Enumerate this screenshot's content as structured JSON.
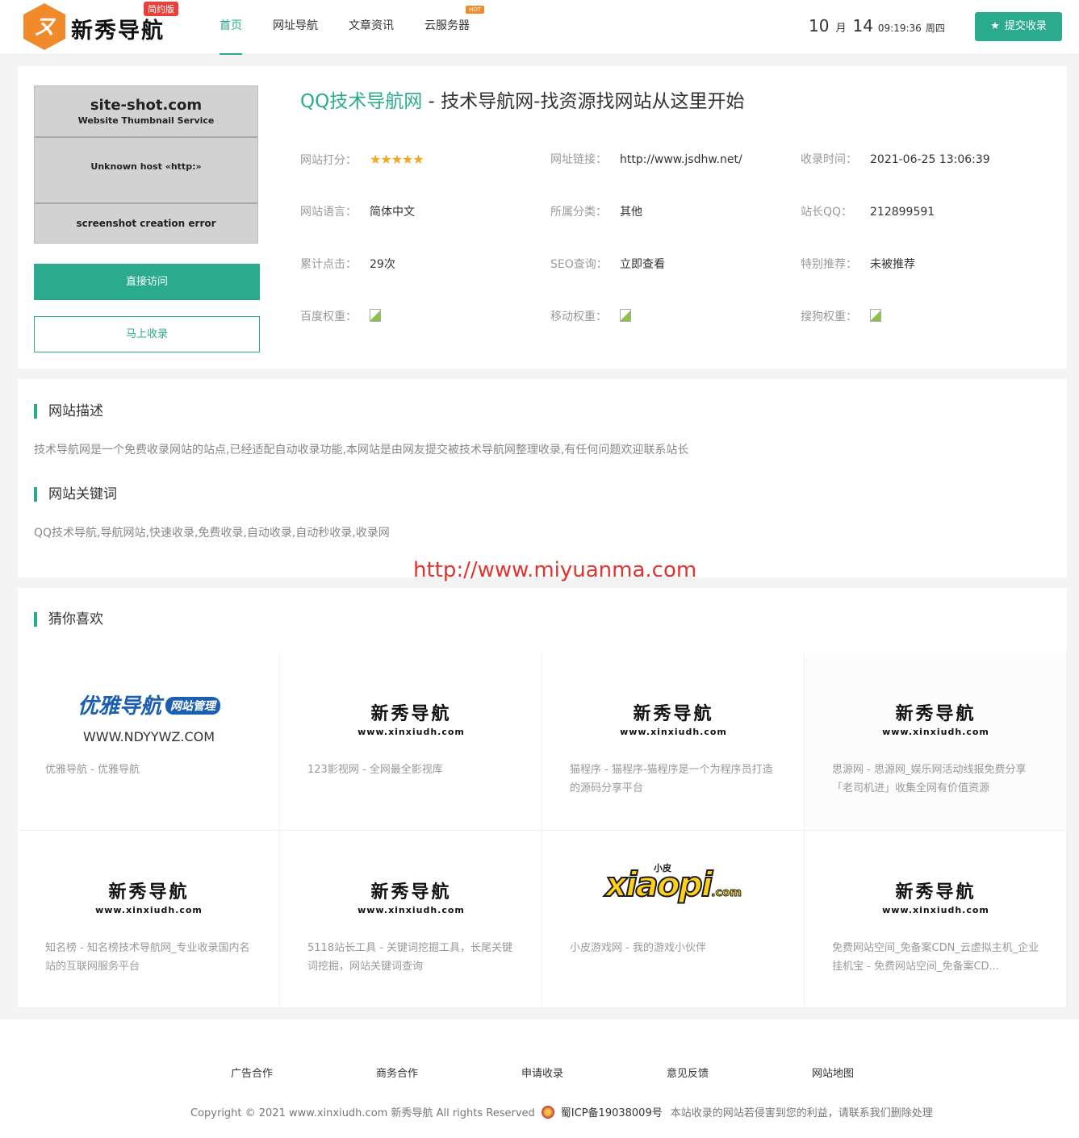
{
  "header": {
    "logo_text": "新秀导航",
    "logo_badge": "简约版",
    "nav": [
      {
        "label": "首页",
        "active": true
      },
      {
        "label": "网址导航",
        "active": false
      },
      {
        "label": "文章资讯",
        "active": false
      },
      {
        "label": "云服务器",
        "active": false,
        "badge": "HOT"
      }
    ],
    "date": {
      "month": "10",
      "month_unit": "月",
      "day": "14",
      "time": "09:19:36",
      "weekday": "周四"
    },
    "submit_label": "提交收录"
  },
  "site": {
    "thumbnail": {
      "title": "site-shot.com",
      "subtitle": "Website Thumbnail Service",
      "message": "Unknown host «http:»",
      "error": "screenshot creation error"
    },
    "visit_label": "直接访问",
    "collect_label": "马上收录",
    "name": "QQ技术导航网",
    "title_rest": " - 技术导航网-找资源找网站从这里开始",
    "fields": {
      "rating_label": "网站打分：",
      "rating_stars": "★★★★★",
      "url_label": "网址链接：",
      "url_value": "http://www.jsdhw.net/",
      "time_label": "收录时间：",
      "time_value": "2021-06-25 13:06:39",
      "lang_label": "网站语言：",
      "lang_value": "简体中文",
      "category_label": "所属分类：",
      "category_value": "其他",
      "qq_label": "站长QQ：",
      "qq_value": "212899591",
      "clicks_label": "累计点击：",
      "clicks_value": "29次",
      "seo_label": "SEO查询：",
      "seo_value": "立即查看",
      "recommend_label": "特别推荐：",
      "recommend_value": "未被推荐",
      "baidu_label": "百度权重：",
      "mobile_label": "移动权重：",
      "sogou_label": "搜狗权重："
    }
  },
  "description": {
    "title": "网站描述",
    "text": "技术导航网是一个免费收录网站的站点,已经适配自动收录功能,本网站是由网友提交被技术导航网整理收录,有任何问题欢迎联系站长",
    "keywords_title": "网站关键词",
    "keywords": "QQ技术导航,导航网站,快速收录,免费收录,自动收录,自动秒收录,收录网"
  },
  "watermark": "http://www.miyuanma.com",
  "recommend": {
    "title": "猜你喜欢",
    "brand": "新秀导航",
    "brand_url": "www.xinxiudh.com",
    "youya": {
      "text": "优雅导航",
      "tag": "网站管理",
      "url": "WWW.NDYYWZ.COM"
    },
    "xiaopi": {
      "small": "小皮",
      "text": "xiaopi",
      "com": ".com"
    },
    "items": [
      {
        "logo": "youya",
        "desc": "优雅导航 - 优雅导航"
      },
      {
        "logo": "brand",
        "desc": "123影视网 - 全网最全影视库"
      },
      {
        "logo": "brand",
        "desc": "猫程序 - 猫程序-猫程序是一个为程序员打造的源码分享平台"
      },
      {
        "logo": "brand",
        "desc": "思源网 - 思源网_娱乐网活动线报免费分享「老司机进」收集全网有价值资源"
      },
      {
        "logo": "brand",
        "desc": "知名榜 - 知名榜技术导航网_专业收录国内名站的互联网服务平台"
      },
      {
        "logo": "brand",
        "desc": "5118站长工具 - 关键词挖掘工具，长尾关键词挖掘，网站关键词查询"
      },
      {
        "logo": "xiaopi",
        "desc": "小皮游戏网 - 我的游戏小伙伴"
      },
      {
        "logo": "brand",
        "desc": "免费网站空间_免备案CDN_云虚拟主机_企业挂机宝 - 免费网站空间_免备案CD..."
      }
    ]
  },
  "footer": {
    "links": [
      "广告合作",
      "商务合作",
      "申请收录",
      "意见反馈",
      "网站地图"
    ],
    "copyright": "Copyright © 2021 www.xinxiudh.com 新秀导航 All rights Reserved",
    "icp": "蜀ICP备19038009号",
    "note": "本站收录的网站若侵害到您的利益，请联系我们删除处理"
  },
  "colors": {
    "accent": "#2bab8d",
    "watermark": "#e5322d",
    "stars": "#f5a623"
  }
}
